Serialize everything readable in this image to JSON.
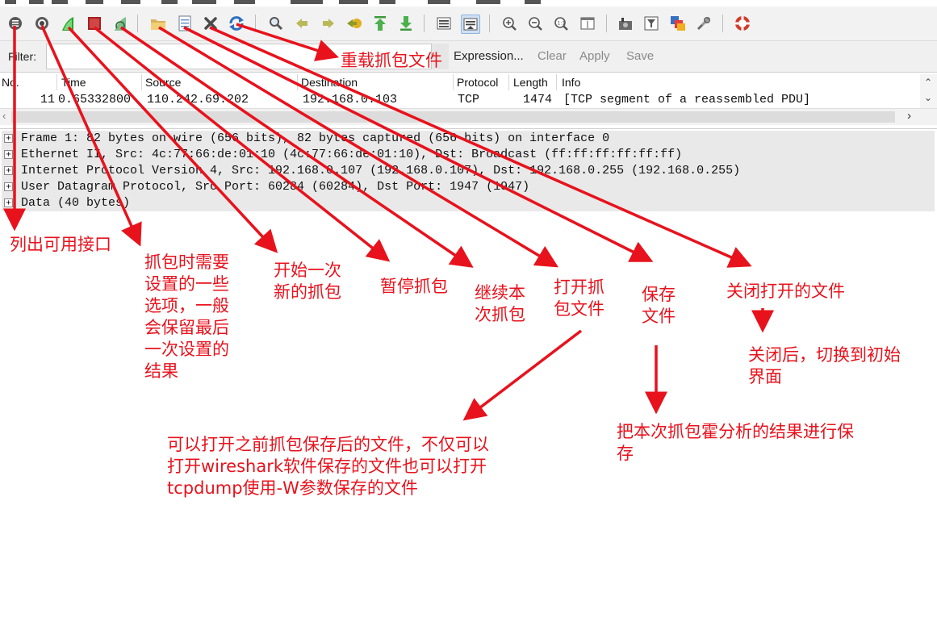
{
  "filter": {
    "label": "Filter:",
    "value": "",
    "expression": "Expression...",
    "clear": "Clear",
    "apply": "Apply",
    "save": "Save"
  },
  "columns": [
    "No.",
    "Time",
    "Source",
    "Destination",
    "Protocol",
    "Length",
    "Info"
  ],
  "packet_row": {
    "no": "11",
    "time": "0.65332800",
    "source": "110.242.69.202",
    "destination": "192.168.0.103",
    "protocol": "TCP",
    "length": "1474",
    "info": "[TCP segment of a reassembled PDU]"
  },
  "details": [
    "Frame 1: 82 bytes on wire (656 bits), 82 bytes captured (656 bits) on interface 0",
    "Ethernet II, Src: 4c:77:66:de:01:10 (4c:77:66:de:01:10), Dst: Broadcast (ff:ff:ff:ff:ff:ff)",
    "Internet Protocol Version 4, Src: 192.168.0.107 (192.168.0.107), Dst: 192.168.0.255 (192.168.0.255)",
    "User Datagram Protocol, Src Port: 60284 (60284), Dst Port: 1947 (1947)",
    "Data (40 bytes)"
  ],
  "annotations": {
    "reload": "重载抓包文件",
    "list_interfaces": "列出可用接口",
    "capture_options": [
      "抓包时需要",
      "设置的一些",
      "选项，一般",
      "会保留最后",
      "一次设置的",
      "结果"
    ],
    "start": [
      "开始一次",
      "新的抓包"
    ],
    "stop": "暂停抓包",
    "restart": [
      "继续本",
      "次抓包"
    ],
    "open": [
      "打开抓",
      "包文件"
    ],
    "save": [
      "保存",
      "文件"
    ],
    "close": "关闭打开的文件",
    "close_note": [
      "关闭后，切换到初始",
      "界面"
    ],
    "open_note": [
      "可以打开之前抓包保存后的文件，不仅可以",
      "打开wireshark软件保存的文件也可以打开",
      "tcpdump使用-W参数保存的文件"
    ],
    "save_note": [
      "把本次抓包霍分析的结果进行保",
      "存"
    ]
  },
  "icons": [
    "list-interfaces-icon",
    "capture-options-icon",
    "start-capture-icon",
    "stop-capture-icon",
    "restart-capture-icon",
    "open-file-icon",
    "save-file-icon",
    "close-file-icon",
    "reload-icon",
    "find-icon",
    "go-back-icon",
    "go-forward-icon",
    "go-to-packet-icon",
    "first-packet-icon",
    "last-packet-icon",
    "colorize-icon",
    "auto-scroll-icon",
    "zoom-in-icon",
    "zoom-out-icon",
    "normal-size-icon",
    "resize-columns-icon",
    "capture-filters-icon",
    "display-filters-icon",
    "coloring-rules-icon",
    "preferences-icon",
    "help-icon"
  ],
  "colors": {
    "annotation": "#e8121c"
  }
}
